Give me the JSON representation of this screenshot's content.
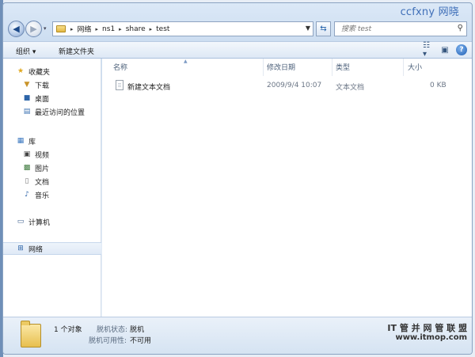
{
  "watermark_top": "ccfxny 网晓",
  "watermark_bottom": {
    "line1": "IT 管 并 网 管 联 盟",
    "line2": "www.itmop.com"
  },
  "window_controls": {
    "minimize": "–",
    "maximize": "□",
    "close": "✕"
  },
  "address": {
    "crumbs": [
      "网络",
      "ns1",
      "share",
      "test"
    ],
    "separator": "▸"
  },
  "search": {
    "placeholder": "搜索 test"
  },
  "toolbar": {
    "organize": "组织 ▾",
    "new_folder": "新建文件夹"
  },
  "sidebar": {
    "favorites": {
      "label": "收藏夹",
      "items": [
        "下载",
        "桌面",
        "最近访问的位置"
      ]
    },
    "libraries": {
      "label": "库",
      "items": [
        "视频",
        "图片",
        "文档",
        "音乐"
      ]
    },
    "computer": "计算机",
    "network": "网络"
  },
  "columns": {
    "name": "名称",
    "date": "修改日期",
    "type": "类型",
    "size": "大小"
  },
  "files": [
    {
      "name": "新建文本文档",
      "date": "2009/9/4 10:07",
      "type": "文本文档",
      "size": "0 KB"
    }
  ],
  "status": {
    "count": "1 个对象",
    "offline_status_label": "脱机状态:",
    "offline_status_value": "脱机",
    "offline_avail_label": "脱机可用性:",
    "offline_avail_value": "不可用"
  },
  "icons": {
    "back": "back-arrow-icon",
    "forward": "forward-arrow-icon",
    "refresh": "refresh-icon",
    "search": "search-icon",
    "view": "view-options-icon",
    "preview": "preview-pane-icon",
    "help": "help-icon"
  }
}
